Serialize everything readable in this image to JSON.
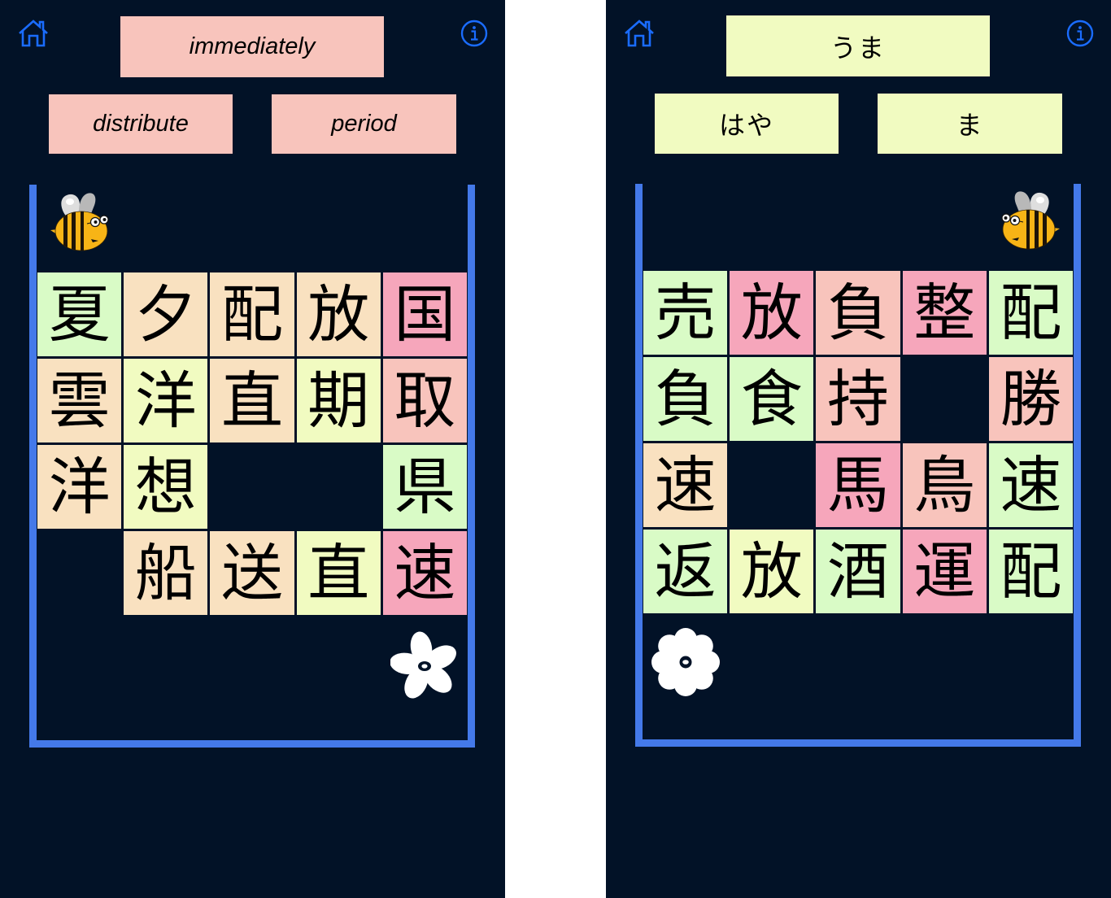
{
  "palette": {
    "background": "#021227",
    "board_border": "#4479e9",
    "icon": "#1a6cff",
    "green": "#d9fbc6",
    "peach": "#f9e1c0",
    "yellow": "#f1fbc1",
    "pink": "#f6a6bb",
    "salmon": "#f8c4bc"
  },
  "panels": [
    {
      "language": "english",
      "icons": {
        "home": "home-icon",
        "info": "info-icon",
        "bee": "bee-icon",
        "flower": "flower-icon"
      },
      "prompt": {
        "label": "immediately",
        "color": "salmon"
      },
      "choices": [
        {
          "label": "distribute",
          "color": "salmon"
        },
        {
          "label": "period",
          "color": "salmon"
        }
      ],
      "grid": [
        [
          {
            "char": "夏",
            "color": "green"
          },
          {
            "char": "夕",
            "color": "peach"
          },
          {
            "char": "配",
            "color": "peach"
          },
          {
            "char": "放",
            "color": "peach"
          },
          {
            "char": "国",
            "color": "pink"
          }
        ],
        [
          {
            "char": "雲",
            "color": "peach"
          },
          {
            "char": "洋",
            "color": "yellow"
          },
          {
            "char": "直",
            "color": "peach"
          },
          {
            "char": "期",
            "color": "yellow"
          },
          {
            "char": "取",
            "color": "salmon"
          }
        ],
        [
          {
            "char": "洋",
            "color": "peach"
          },
          {
            "char": "想",
            "color": "yellow"
          },
          null,
          null,
          {
            "char": "県",
            "color": "green"
          }
        ],
        [
          null,
          {
            "char": "船",
            "color": "peach"
          },
          {
            "char": "送",
            "color": "peach"
          },
          {
            "char": "直",
            "color": "yellow"
          },
          {
            "char": "速",
            "color": "pink"
          }
        ]
      ]
    },
    {
      "language": "japanese",
      "icons": {
        "home": "home-icon",
        "info": "info-icon",
        "bee": "bee-icon",
        "flower": "flower-icon"
      },
      "prompt": {
        "label": "うま",
        "color": "yellow"
      },
      "choices": [
        {
          "label": "はや",
          "color": "yellow"
        },
        {
          "label": "ま",
          "color": "yellow"
        }
      ],
      "grid": [
        [
          {
            "char": "売",
            "color": "green"
          },
          {
            "char": "放",
            "color": "pink"
          },
          {
            "char": "負",
            "color": "salmon"
          },
          {
            "char": "整",
            "color": "pink"
          },
          {
            "char": "配",
            "color": "green"
          }
        ],
        [
          {
            "char": "負",
            "color": "green"
          },
          {
            "char": "食",
            "color": "green"
          },
          {
            "char": "持",
            "color": "salmon"
          },
          null,
          {
            "char": "勝",
            "color": "salmon"
          }
        ],
        [
          {
            "char": "速",
            "color": "peach"
          },
          null,
          {
            "char": "馬",
            "color": "pink"
          },
          {
            "char": "鳥",
            "color": "salmon"
          },
          {
            "char": "速",
            "color": "green"
          }
        ],
        [
          {
            "char": "返",
            "color": "green"
          },
          {
            "char": "放",
            "color": "yellow"
          },
          {
            "char": "酒",
            "color": "green"
          },
          {
            "char": "運",
            "color": "pink"
          },
          {
            "char": "配",
            "color": "green"
          }
        ]
      ]
    }
  ]
}
